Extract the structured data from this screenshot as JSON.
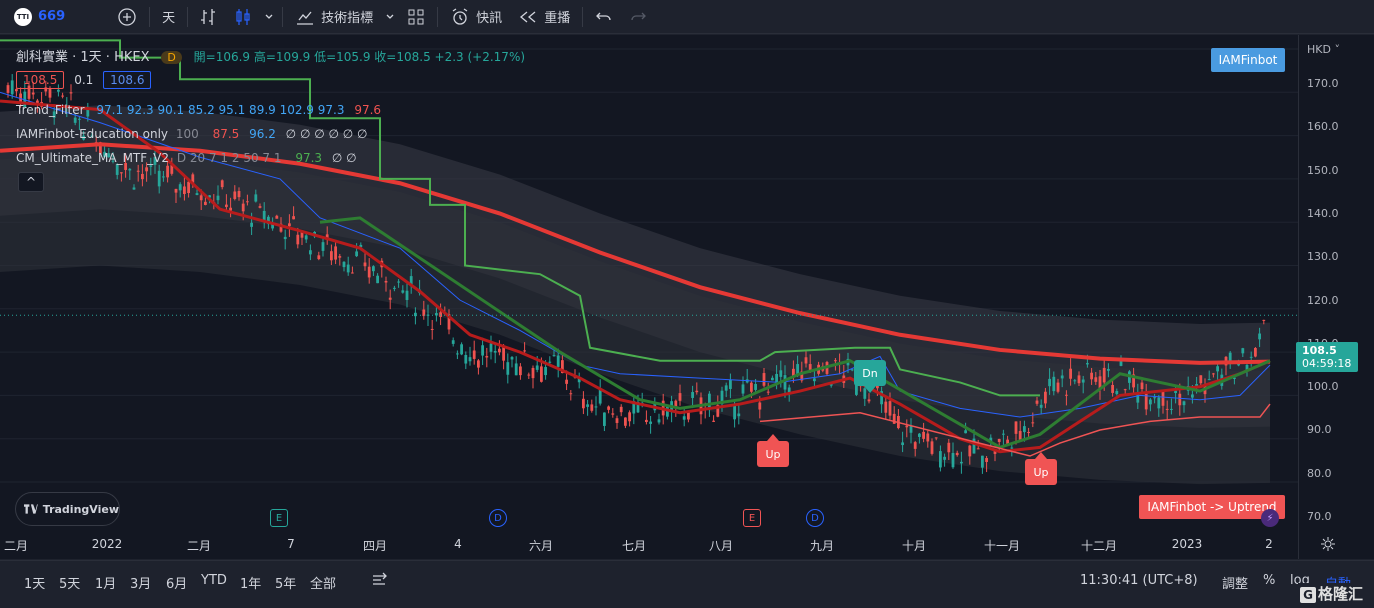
{
  "toolbar": {
    "symbol_code": "669",
    "interval": "天",
    "indicators_label": "技術指標",
    "alerts_label": "快訊",
    "replay_label": "重播"
  },
  "legend": {
    "symbol": "創科實業 · 1天 · HKEX",
    "badge": "D",
    "ohlc": "開=106.9  高=109.9  低=105.9  收=108.5  +2.3 (+2.17%)",
    "bid": "108.5",
    "spread": "0.1",
    "ask": "108.6",
    "ind1_name": "Trend_Filter",
    "ind1_vals": "97.1  92.3  90.1  85.2  95.1  89.9  102.9  97.3",
    "ind1_last": "97.6",
    "ind2_name": "IAMFinbot-Education only",
    "ind2_param": "100",
    "ind2_v1": "87.5",
    "ind2_v2": "96.2",
    "ind2_rest": "∅  ∅  ∅  ∅  ∅  ∅",
    "ind3_name": "CM_Ultimate_MA_MTF_V2",
    "ind3_params": "D 20 7 1 2 50 7 1",
    "ind3_v": "97.3",
    "ind3_rest": "∅  ∅",
    "collapse": "^"
  },
  "price_axis": {
    "currency": "HKD",
    "ticks": [
      "170.0",
      "160.0",
      "150.0",
      "140.0",
      "130.0",
      "120.0",
      "110.0",
      "100.0",
      "90.0",
      "80.0",
      "70.0"
    ],
    "last_price": "108.5",
    "countdown": "04:59:18"
  },
  "time_axis": {
    "ticks": [
      "二月",
      "2022",
      "二月",
      "7",
      "四月",
      "4",
      "六月",
      "七月",
      "八月",
      "九月",
      "十月",
      "十一月",
      "十二月",
      "2023",
      "2"
    ]
  },
  "labels": {
    "iam_top": "IAMFinbot",
    "iam_bottom": "IAMFinbot -> Uptrend",
    "up1": "Up",
    "dn1": "Dn",
    "up2": "Up",
    "tv_logo": "TradingView",
    "event_e": "E",
    "event_d": "D"
  },
  "bottombar": {
    "ranges": [
      "1天",
      "5天",
      "1月",
      "3月",
      "6月",
      "YTD",
      "1年",
      "5年",
      "全部"
    ],
    "clock": "11:30:41 (UTC+8)",
    "adjust": "調整",
    "percent": "%",
    "log": "log",
    "auto": "自動",
    "watermark": "格隆汇"
  },
  "colors": {
    "up": "#26a69a",
    "down": "#ef5350",
    "ma_red": "#e53935",
    "trend_green": "#4caf50",
    "blue_line": "#2962ff"
  }
}
